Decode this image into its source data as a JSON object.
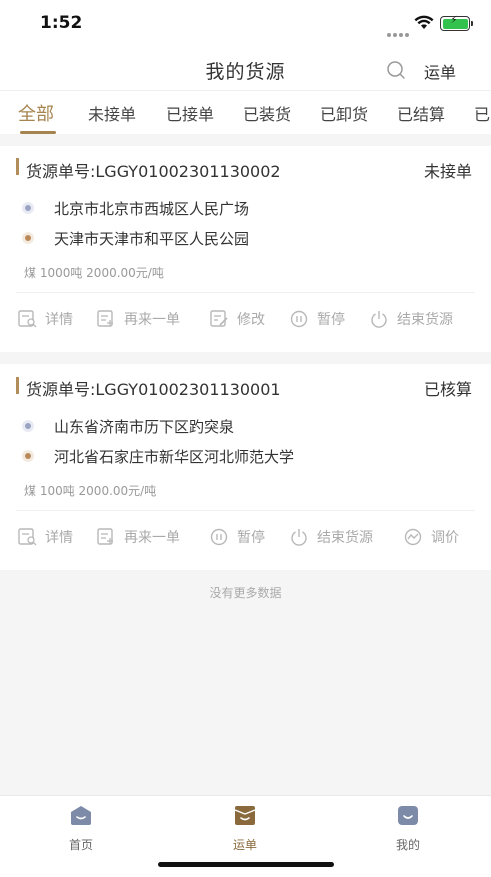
{
  "status_bar": {
    "time": "1:52"
  },
  "nav": {
    "title": "我的货源",
    "waybill_link": "运单"
  },
  "filter_tabs": [
    {
      "label": "全部",
      "active": true
    },
    {
      "label": "未接单"
    },
    {
      "label": "已接单"
    },
    {
      "label": "已装货"
    },
    {
      "label": "已卸货"
    },
    {
      "label": "已结算"
    },
    {
      "label": "已"
    }
  ],
  "orders": [
    {
      "order_label": "货源单号:LGGY01002301130002",
      "status": "未接单",
      "from": "北京市北京市西城区人民广场",
      "to": "天津市天津市和平区人民公园",
      "cargo": "煤 1000吨 2000.00元/吨",
      "actions": [
        "详情",
        "再来一单",
        "修改",
        "暂停",
        "结束货源"
      ]
    },
    {
      "order_label": "货源单号:LGGY01002301130001",
      "status": "已核算",
      "from": "山东省济南市历下区趵突泉",
      "to": "河北省石家庄市新华区河北师范大学",
      "cargo": "煤 100吨 2000.00元/吨",
      "actions": [
        "详情",
        "再来一单",
        "暂停",
        "结束货源",
        "调价"
      ]
    }
  ],
  "list_footer": "没有更多数据",
  "tabbar": [
    {
      "label": "首页"
    },
    {
      "label": "运单",
      "active": true
    },
    {
      "label": "我的"
    }
  ],
  "colors": {
    "accent": "#a6844f",
    "active_icon": "#8a6a3d",
    "inactive_icon": "#7d8aa8"
  }
}
